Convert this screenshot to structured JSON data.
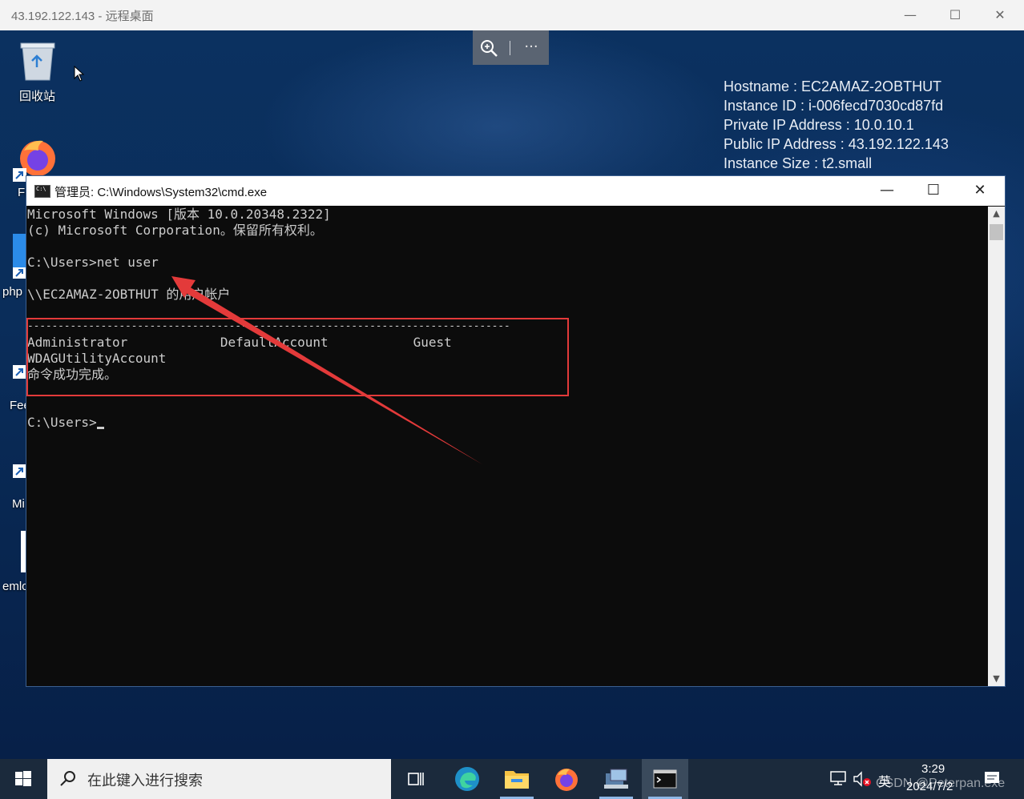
{
  "rdp": {
    "title": "43.192.122.143 - 远程桌面",
    "minimize": "—",
    "maximize": "☐",
    "close": "✕",
    "more": "···"
  },
  "desktop_icons": [
    {
      "label": "回收站"
    },
    {
      "label": "Fi"
    },
    {
      "label": "php"
    },
    {
      "label": "Fee"
    },
    {
      "label": "Mi"
    },
    {
      "label": "emlo"
    }
  ],
  "instance_info": {
    "hostname": "Hostname : EC2AMAZ-2OBTHUT",
    "instance_id": "Instance ID : i-006fecd7030cd87fd",
    "private_ip": "Private IP Address : 10.0.10.1",
    "public_ip": "Public IP Address : 43.192.122.143",
    "instance_size": "Instance Size : t2.small"
  },
  "cmd": {
    "title": "管理员: C:\\Windows\\System32\\cmd.exe",
    "lines": [
      "Microsoft Windows [版本 10.0.20348.2322]",
      "(c) Microsoft Corporation。保留所有权利。",
      "",
      "C:\\Users>net user",
      "",
      "\\\\EC2AMAZ-2OBTHUT 的用户帐户",
      "",
      "-------------------------------------------------------------------------------",
      "Administrator            DefaultAccount           Guest",
      "WDAGUtilityAccount",
      "命令成功完成。",
      "",
      "C:\\Users>"
    ]
  },
  "taskbar": {
    "search_placeholder": "在此键入进行搜索",
    "ime": "英",
    "time": "3:29",
    "date": "2024/7/2",
    "watermark": "CSDN @Peterpan.exe"
  },
  "colors": {
    "annotation_red": "#e33a3a",
    "console_bg": "#0c0c0c",
    "console_fg": "#cccccc"
  }
}
